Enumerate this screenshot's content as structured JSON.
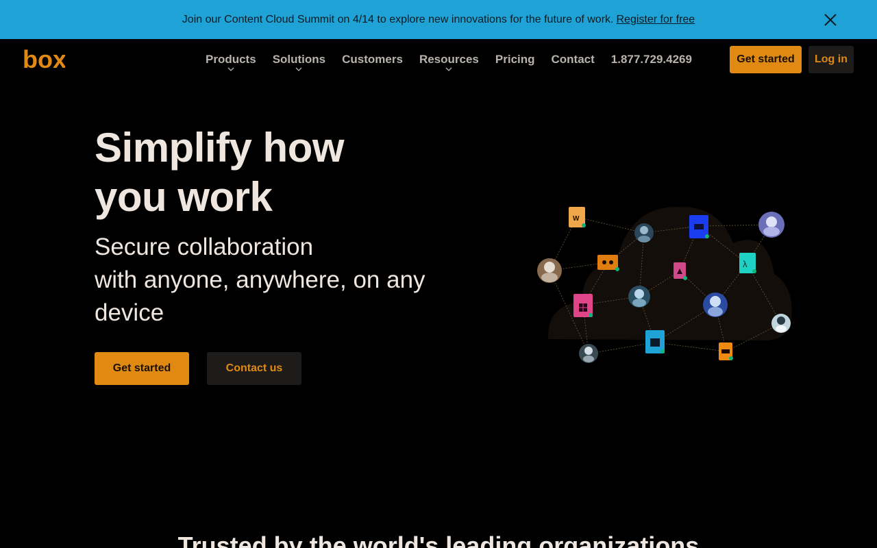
{
  "banner": {
    "message": "Join our Content Cloud Summit on 4/14 to explore new innovations for the future of work.",
    "link": "Register for free",
    "close_icon": "close-icon"
  },
  "nav": {
    "logo": "box",
    "items": [
      {
        "label": "Products",
        "has_dropdown": true
      },
      {
        "label": "Solutions",
        "has_dropdown": true
      },
      {
        "label": "Customers",
        "has_dropdown": false
      },
      {
        "label": "Resources",
        "has_dropdown": true
      },
      {
        "label": "Pricing",
        "has_dropdown": false
      },
      {
        "label": "Contact",
        "has_dropdown": false
      },
      {
        "label": "1.877.729.4269",
        "has_dropdown": false
      }
    ],
    "get_started": "Get started",
    "log_in": "Log in"
  },
  "hero": {
    "title_line1": "Simplify how",
    "title_line2": "you work",
    "sub_line1": "Secure collaboration",
    "sub_line2": "with anyone, anywhere, on any",
    "sub_line3": "device",
    "get_started": "Get started",
    "contact_us": "Contact us"
  },
  "trusted": {
    "heading": "Trusted by the world's leading organizations"
  },
  "colors": {
    "banner_bg": "#1fa3d6",
    "accent": "#e08a13",
    "background": "#000000"
  }
}
